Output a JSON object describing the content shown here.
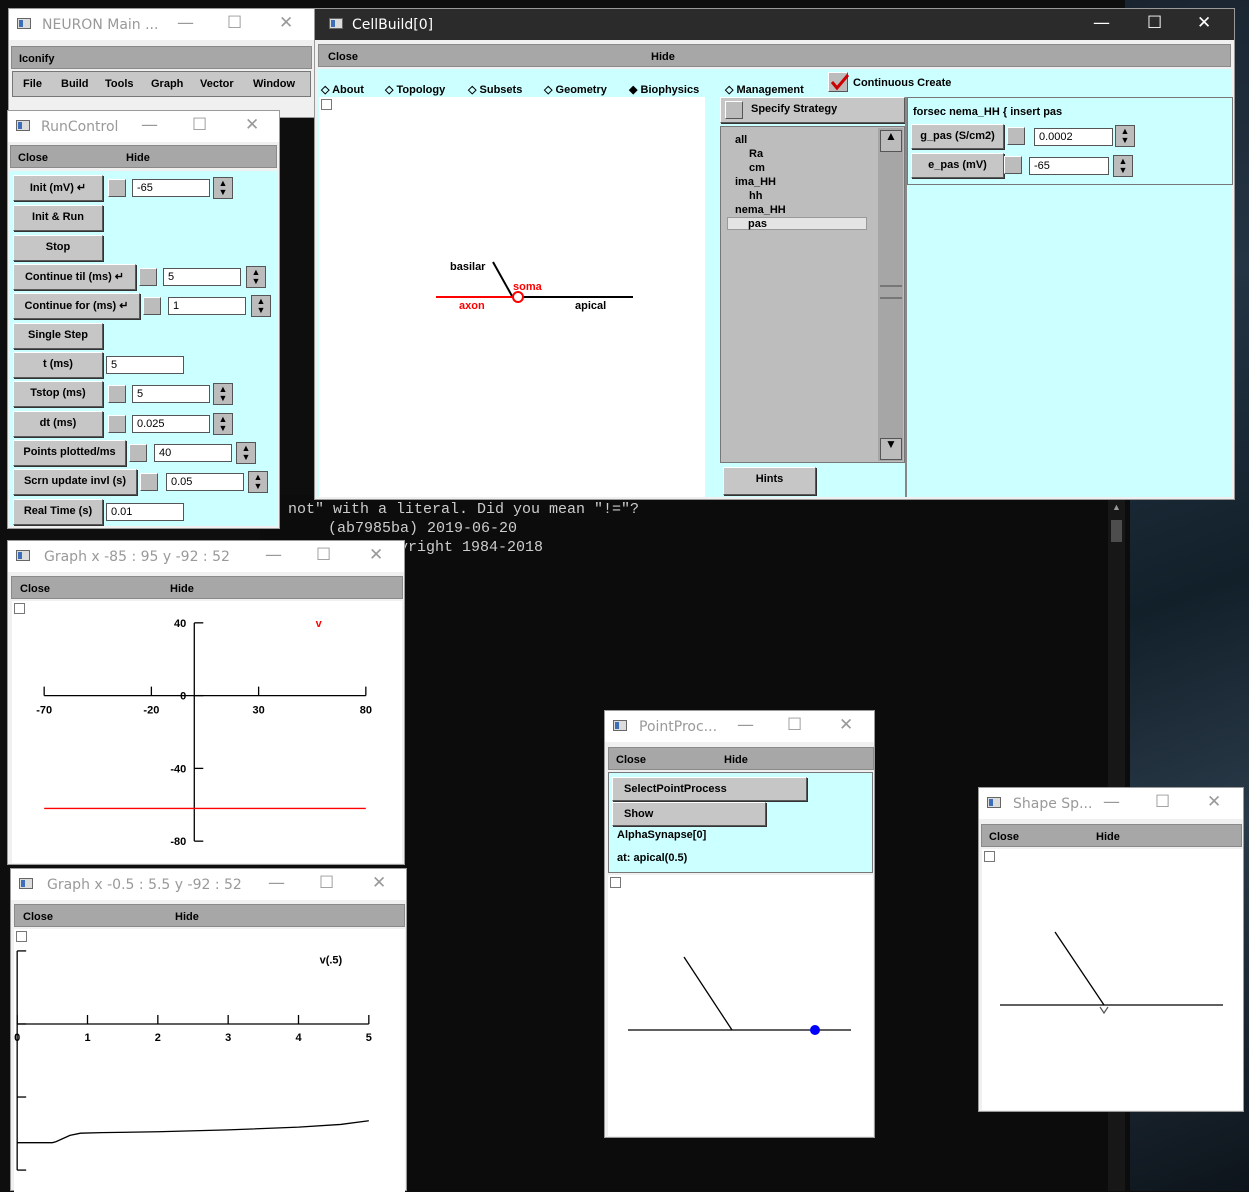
{
  "console": {
    "line1": "not\" with a literal. Did you mean \"!=\"?",
    "line2": "(ab7985ba) 2019-06-20",
    "line3": "yright 1984-2018"
  },
  "neuron_main": {
    "title": "NEURON Main ...",
    "iconify_label": "Iconify",
    "menu": [
      "File",
      "Build",
      "Tools",
      "Graph",
      "Vector",
      "Window"
    ]
  },
  "cellbuild": {
    "title": "CellBuild[0]",
    "close_label": "Close",
    "hide_label": "Hide",
    "tabs": [
      "About",
      "Topology",
      "Subsets",
      "Geometry",
      "Biophysics",
      "Management"
    ],
    "continuous_create": "Continuous Create",
    "specify_strategy": "Specify Strategy",
    "hints": "Hints",
    "tree": [
      "all",
      "Ra",
      "cm",
      "ima_HH",
      "hh",
      "nema_HH",
      "pas"
    ],
    "header": "forsec nema_HH { insert pas",
    "gpas_label": "g_pas (S/cm2)",
    "gpas_value": "0.0002",
    "epas_label": "e_pas (mV)",
    "epas_value": "-65",
    "topo": {
      "basilar": "basilar",
      "soma": "soma",
      "axon": "axon",
      "apical": "apical"
    }
  },
  "runcontrol": {
    "title": "RunControl",
    "close_label": "Close",
    "hide_label": "Hide",
    "init_label": "Init (mV) ↵",
    "init_value": "-65",
    "init_run": "Init & Run",
    "stop": "Stop",
    "continue_til_label": "Continue til (ms) ↵",
    "continue_til_value": "5",
    "continue_for_label": "Continue for (ms) ↵",
    "continue_for_value": "1",
    "single_step": "Single Step",
    "t_label": "t (ms)",
    "t_value": "5",
    "tstop_label": "Tstop (ms)",
    "tstop_value": "5",
    "dt_label": "dt (ms)",
    "dt_value": "0.025",
    "points_label": "Points plotted/ms",
    "points_value": "40",
    "scrn_label": "Scrn update invl (s)",
    "scrn_value": "0.05",
    "realtime_label": "Real Time (s)",
    "realtime_value": "0.01"
  },
  "graph1": {
    "title": "Graph  x -85 : 95  y -92 : 52",
    "close_label": "Close",
    "hide_label": "Hide",
    "marker": "v"
  },
  "graph2": {
    "title": "Graph  x -0.5 : 5.5  y -92 : 52",
    "close_label": "Close",
    "hide_label": "Hide",
    "series_label": "v(.5)"
  },
  "pointproc": {
    "title": "PointProc...",
    "close_label": "Close",
    "hide_label": "Hide",
    "select": "SelectPointProcess",
    "show": "Show",
    "name": "AlphaSynapse[0]",
    "location": "at: apical(0.5)"
  },
  "shapesp": {
    "title": "Shape Sp...",
    "close_label": "Close",
    "hide_label": "Hide"
  },
  "chart_data": [
    {
      "type": "scatter",
      "xlim": [
        -85,
        95
      ],
      "ylim": [
        -92,
        52
      ],
      "x_ticks": [
        -70,
        -20,
        30,
        80
      ],
      "y_ticks": [
        40,
        0,
        -40,
        -80
      ],
      "series": [
        {
          "color": "#ff0000",
          "x": [
            -70,
            80
          ],
          "y": [
            -62,
            -62
          ]
        }
      ],
      "points": [
        {
          "x": 58,
          "y": 40,
          "label": "v",
          "color": "#ff0000"
        }
      ]
    },
    {
      "type": "line",
      "xlim": [
        -0.5,
        5.5
      ],
      "ylim": [
        -92,
        52
      ],
      "x_ticks": [
        0,
        1,
        2,
        3,
        4,
        5
      ],
      "y_ticks": [
        40,
        0,
        -40,
        -80
      ],
      "series": [
        {
          "name": "v(.5)",
          "color": "#000000",
          "x": [
            0,
            0.5,
            0.55,
            0.75,
            0.9,
            1.2,
            2,
            3,
            4,
            4.6,
            5
          ],
          "y": [
            -65,
            -65,
            -64.5,
            -61,
            -59.8,
            -59.5,
            -59,
            -58,
            -56.5,
            -55,
            -53
          ]
        }
      ]
    }
  ]
}
